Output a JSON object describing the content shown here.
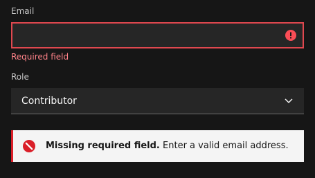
{
  "form": {
    "email": {
      "label": "Email",
      "value": "",
      "placeholder": "",
      "error": "Required field"
    },
    "role": {
      "label": "Role",
      "selected": "Contributor"
    }
  },
  "notification": {
    "kind": "error",
    "title": "Missing required field.",
    "message": "Enter a valid email address."
  },
  "colors": {
    "background": "#161616",
    "field": "#262626",
    "error": "#da1e28",
    "error_text": "#ff8389",
    "notification_bg": "#f4f4f4"
  }
}
